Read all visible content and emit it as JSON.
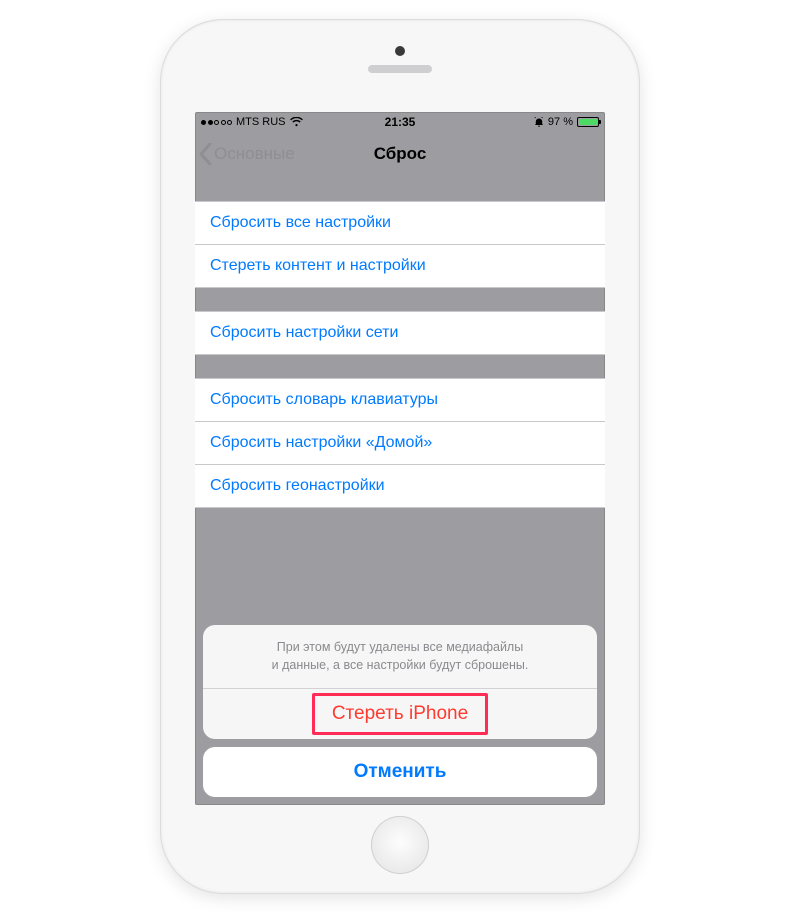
{
  "statusbar": {
    "carrier": "MTS RUS",
    "time": "21:35",
    "battery_pct": "97 %",
    "signal_filled": 2,
    "signal_total": 5
  },
  "navbar": {
    "back_label": "Основные",
    "title": "Сброс"
  },
  "groups": [
    {
      "items": [
        {
          "label": "Сбросить все настройки"
        },
        {
          "label": "Стереть контент и настройки"
        }
      ]
    },
    {
      "items": [
        {
          "label": "Сбросить настройки сети"
        }
      ]
    },
    {
      "items": [
        {
          "label": "Сбросить словарь клавиатуры"
        },
        {
          "label": "Сбросить настройки «Домой»"
        },
        {
          "label": "Сбросить геонастройки"
        }
      ]
    }
  ],
  "sheet": {
    "message_line1": "При этом будут удалены все медиафайлы",
    "message_line2": "и данные, а все настройки будут сброшены.",
    "destructive_label": "Стереть iPhone",
    "cancel_label": "Отменить"
  },
  "colors": {
    "accent": "#007aff",
    "destructive": "#ff3b30",
    "highlight": "#ff2d55",
    "battery_fill": "#4cd964"
  }
}
